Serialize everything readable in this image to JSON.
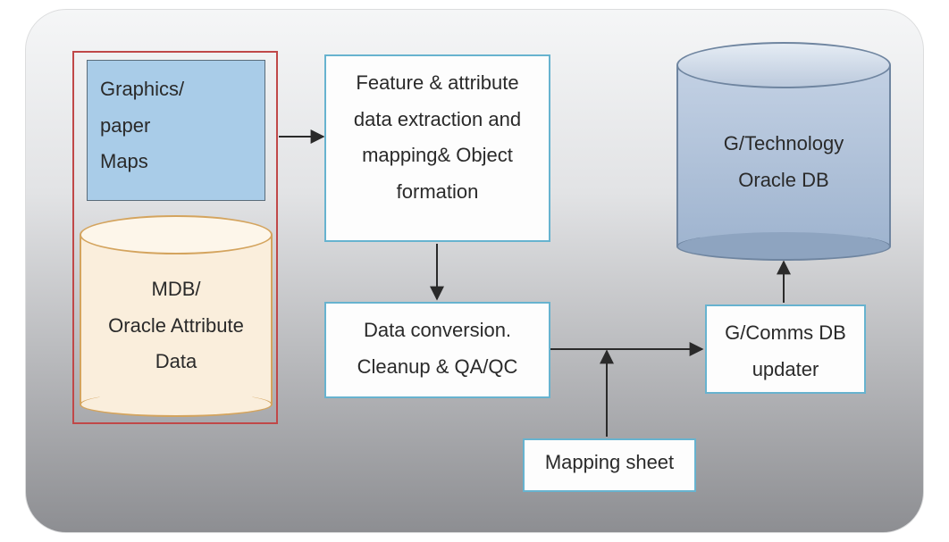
{
  "nodes": {
    "graphics_maps": {
      "l1": "Graphics/",
      "l2": "paper",
      "l3": "Maps"
    },
    "mdb_oracle": {
      "l1": "MDB/",
      "l2": "Oracle   Attribute",
      "l3": "Data"
    },
    "feature_extract": {
      "l1": "Feature & attribute",
      "l2": "data extraction and",
      "l3": "mapping& Object",
      "l4": "formation"
    },
    "data_conv": {
      "l1": "Data conversion.",
      "l2": "Cleanup & QA/QC"
    },
    "mapping_sheet": {
      "l1": "Mapping sheet"
    },
    "gcomms": {
      "l1": "G/Comms DB",
      "l2": "updater"
    },
    "gtech_db": {
      "l1": "G/Technology",
      "l2": "Oracle DB"
    }
  }
}
